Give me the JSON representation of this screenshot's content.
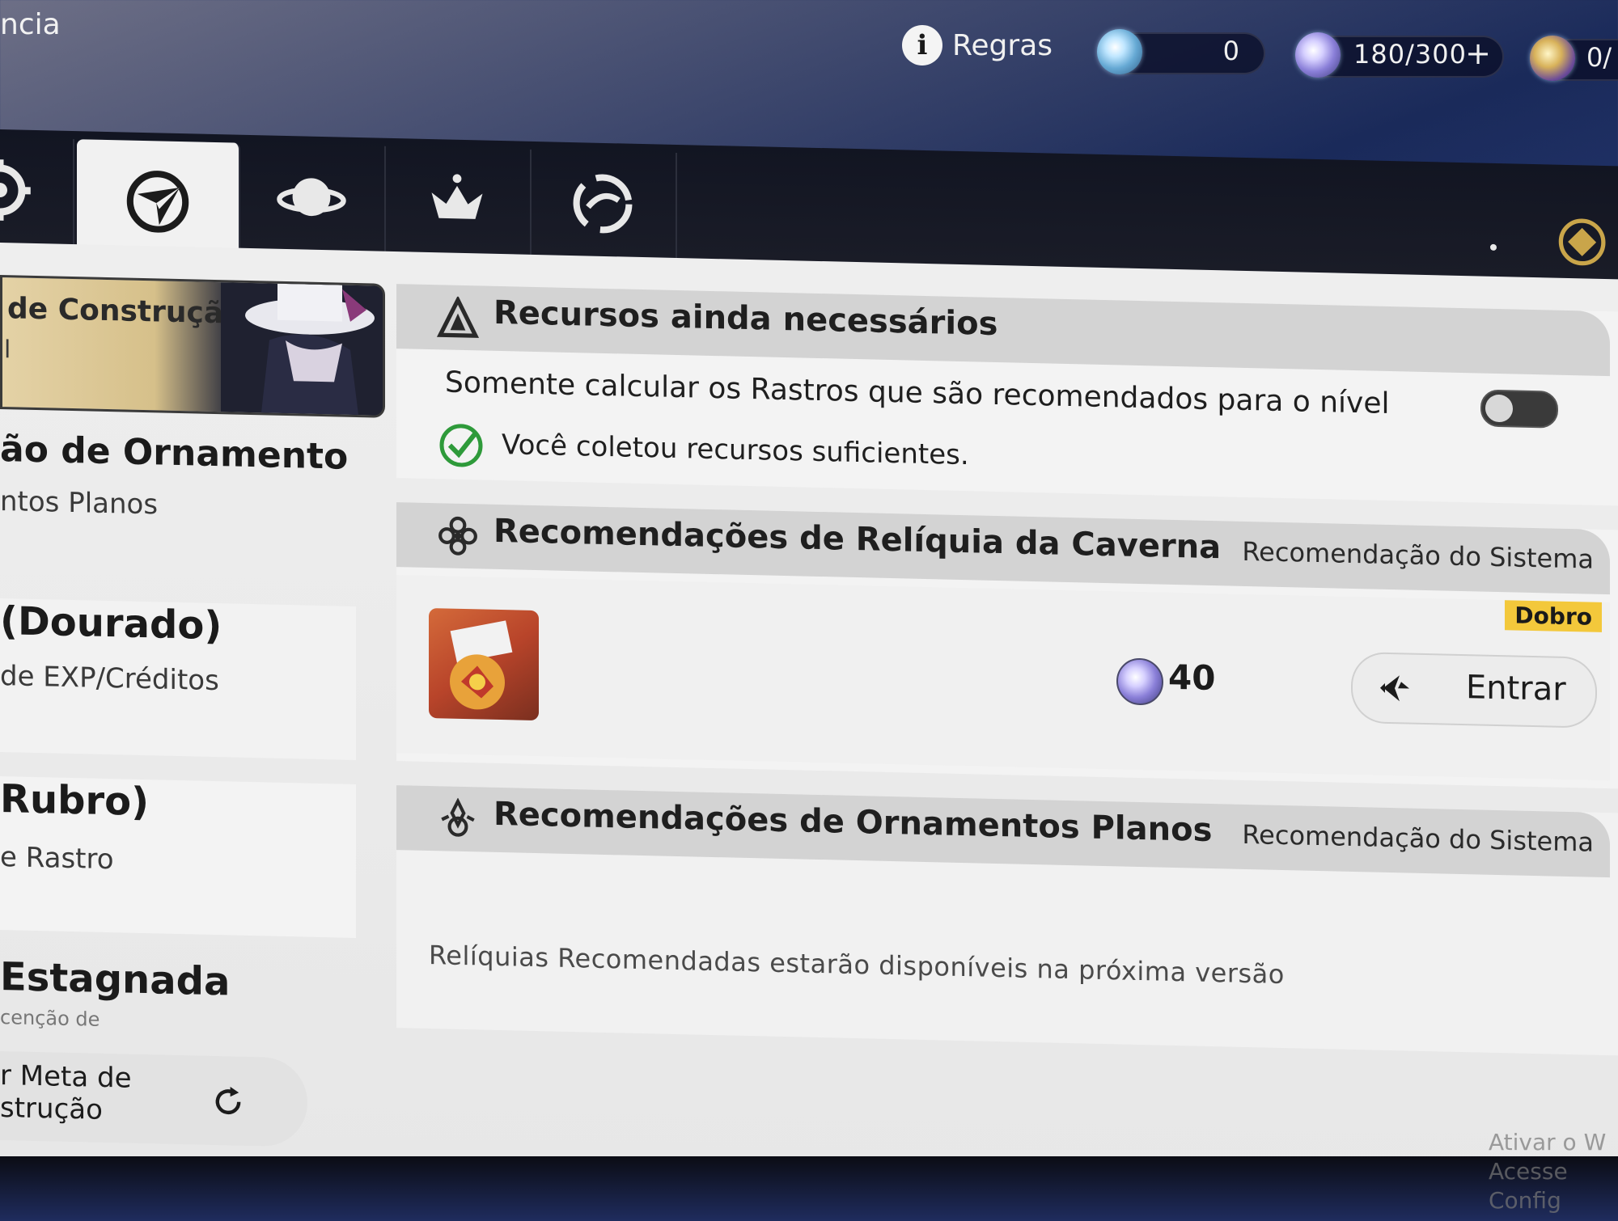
{
  "topbar": {
    "window_title": "ncia",
    "rules_label": "Regras",
    "stellar_jade_value": "0",
    "trailblaze_power": "180/300",
    "power_plus": "+",
    "reserve_value": "0/"
  },
  "tabs": [
    {
      "icon": "gear-icon"
    },
    {
      "icon": "compass-icon",
      "selected": true
    },
    {
      "icon": "planet-icon"
    },
    {
      "icon": "relic-crown-icon"
    },
    {
      "icon": "swirl-icon"
    }
  ],
  "sidebar": {
    "items": [
      {
        "title": "de Construção",
        "subtitle": "l"
      },
      {
        "title": "ão de Ornamento",
        "subtitle": "ntos Planos"
      },
      {
        "title": "(Dourado)",
        "subtitle": "de EXP/Créditos"
      },
      {
        "title": "Rubro)",
        "subtitle": "e Rastro"
      },
      {
        "title": "Estagnada",
        "subtitle": "cenção de"
      }
    ],
    "build_goal_line1": "r Meta de",
    "build_goal_line2": "strução"
  },
  "resources": {
    "title": "Recursos ainda necessários",
    "toggle_label": "Somente calcular os Rastros que são recomendados para o nível",
    "toggle_on": false,
    "status_text": "Você coletou recursos suficientes."
  },
  "cavern": {
    "title": "Recomendações de Relíquia da Caverna",
    "right_label": "Recomendação do Sistema",
    "badge": "Dobro",
    "cost": "40",
    "enter_label": "Entrar"
  },
  "planar": {
    "title": "Recomendações de Ornamentos Planos",
    "right_label": "Recomendação do Sistema",
    "note": "Relíquias Recomendadas estarão disponíveis na próxima versão"
  },
  "watermark": {
    "line1": "Ativar o W",
    "line2": "Acesse Config"
  },
  "colors": {
    "badge": "#f3c83b",
    "check": "#2e9a3a",
    "tab_selected": "#f1f1f1",
    "tab_bar": "#151826"
  }
}
